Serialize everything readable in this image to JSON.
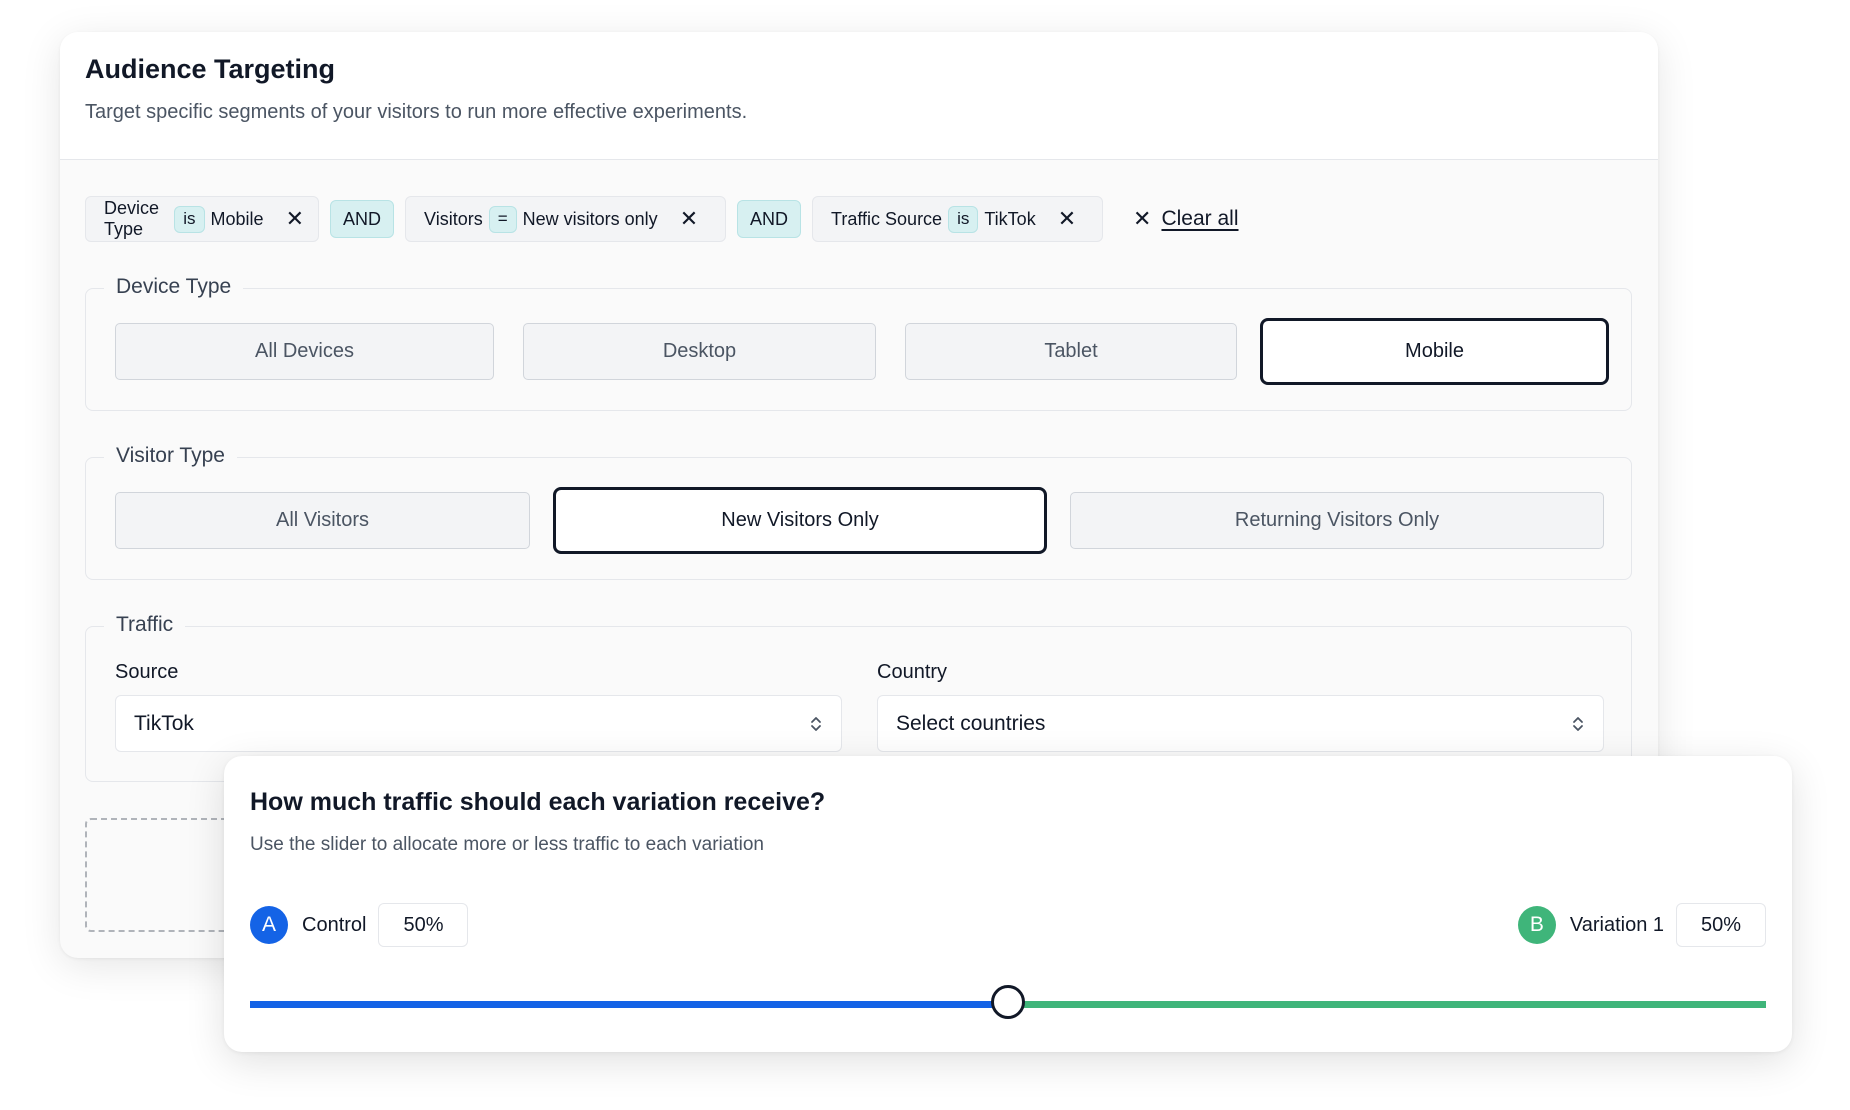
{
  "header": {
    "title": "Audience Targeting",
    "subtitle": "Target specific segments of your visitors to run more effective experiments."
  },
  "filters": {
    "chips": [
      {
        "field": "Device Type",
        "operator": "is",
        "value": "Mobile"
      },
      {
        "field": "Visitors",
        "operator": "=",
        "value": "New visitors only"
      },
      {
        "field": "Traffic Source",
        "operator": "is",
        "value": "TikTok"
      }
    ],
    "joiners": [
      "AND",
      "AND"
    ],
    "remove_glyph": "✕",
    "clear_all_label": "Clear all"
  },
  "device_type": {
    "legend": "Device Type",
    "options": [
      "All Devices",
      "Desktop",
      "Tablet",
      "Mobile"
    ],
    "selected": "Mobile"
  },
  "visitor_type": {
    "legend": "Visitor Type",
    "options": [
      "All Visitors",
      "New Visitors Only",
      "Returning Visitors Only"
    ],
    "selected": "New Visitors Only"
  },
  "traffic": {
    "legend": "Traffic",
    "source": {
      "label": "Source",
      "value": "TikTok"
    },
    "country": {
      "label": "Country",
      "placeholder": "Select countries"
    }
  },
  "allocation": {
    "title": "How much traffic should each variation receive?",
    "subtitle": "Use the slider to allocate more or less traffic to each variation",
    "variations": [
      {
        "badge": "A",
        "name": "Control",
        "percent": "50%",
        "color": "#1463e6"
      },
      {
        "badge": "B",
        "name": "Variation 1",
        "percent": "50%",
        "color": "#3fb57a"
      }
    ],
    "split": 0.5
  },
  "icons": {
    "remove": "close-icon",
    "clear_all": "close-icon",
    "select": "chevron-up-down-icon"
  },
  "colors": {
    "accent_a": "#1463e6",
    "accent_b": "#3fb57a",
    "operator_bg": "#d7f0f1",
    "selected_border": "#111827"
  }
}
